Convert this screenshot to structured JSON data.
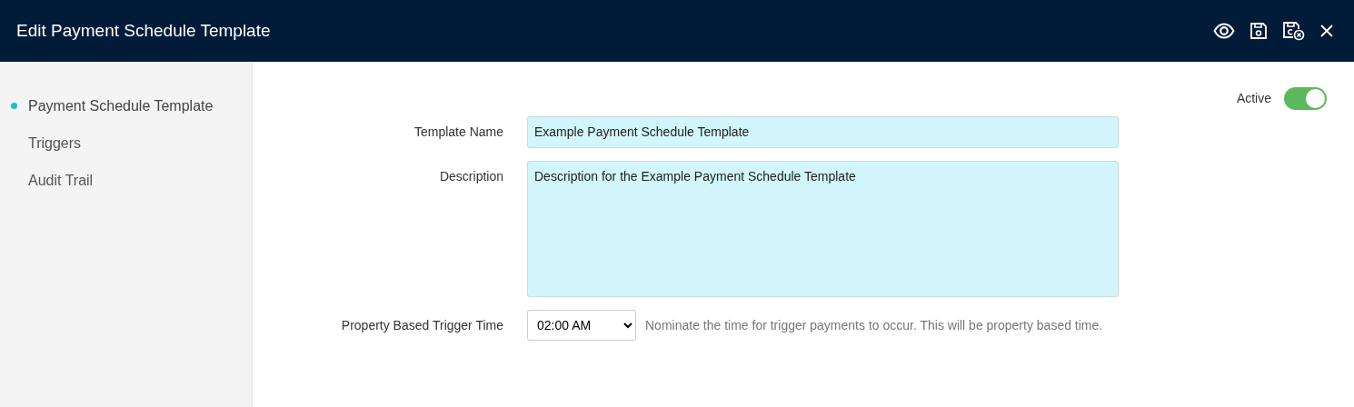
{
  "window": {
    "title": "Edit Payment Schedule Template"
  },
  "sidebar": {
    "items": [
      {
        "label": "Payment Schedule Template",
        "selected": true
      },
      {
        "label": "Triggers",
        "selected": false
      },
      {
        "label": "Audit Trail",
        "selected": false
      }
    ]
  },
  "active_toggle": {
    "label": "Active",
    "on": true
  },
  "form": {
    "template_name": {
      "label": "Template Name",
      "value": "Example Payment Schedule Template"
    },
    "description": {
      "label": "Description",
      "value": "Description for the Example Payment Schedule Template"
    },
    "trigger_time": {
      "label": "Property Based Trigger Time",
      "value": "02:00 AM",
      "help": "Nominate the time for trigger payments to occur.  This will be property based time."
    }
  }
}
